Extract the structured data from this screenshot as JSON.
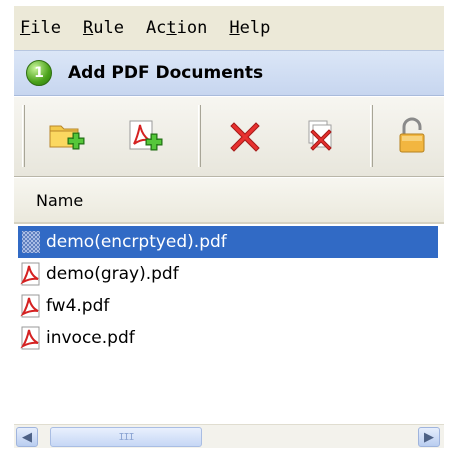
{
  "menu": {
    "items": [
      {
        "accel": "F",
        "rest": "ile"
      },
      {
        "accel": "R",
        "rest": "ule"
      },
      {
        "pre": "Ac",
        "accel": "t",
        "rest": "ion"
      },
      {
        "accel": "H",
        "rest": "elp"
      }
    ]
  },
  "step": {
    "number": "1",
    "title": "Add PDF Documents"
  },
  "toolbar": {
    "buttons": [
      "add-folder-icon",
      "add-pdf-icon",
      "remove-icon",
      "remove-all-icon",
      "lock-icon"
    ]
  },
  "list": {
    "header": "Name",
    "files": [
      {
        "name": "demo(encrptyed).pdf",
        "icon": "encrypted-file-icon",
        "selected": true
      },
      {
        "name": "demo(gray).pdf",
        "icon": "pdf-file-icon",
        "selected": false
      },
      {
        "name": "fw4.pdf",
        "icon": "pdf-file-icon",
        "selected": false
      },
      {
        "name": "invoce.pdf",
        "icon": "pdf-file-icon",
        "selected": false
      }
    ]
  },
  "scrollbar": {
    "thumb_grip": "III"
  },
  "colors": {
    "selection": "#316ac5",
    "menubar": "#ece9d8",
    "stepbar": "#c7d6ef"
  }
}
